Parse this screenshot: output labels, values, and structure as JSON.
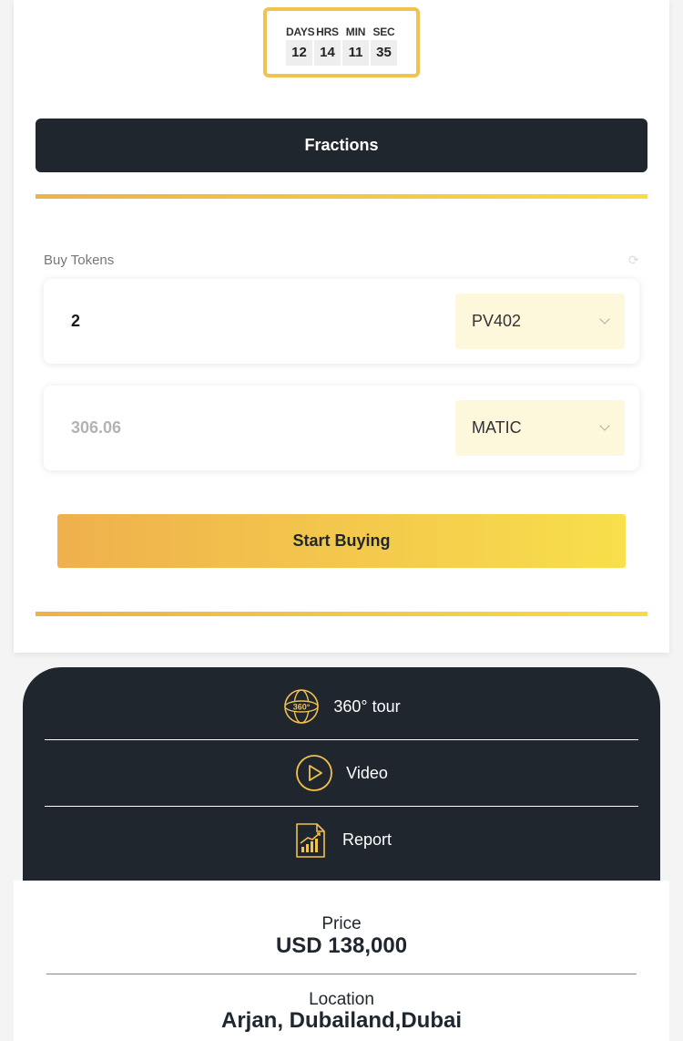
{
  "countdown": {
    "labels": {
      "days": "DAYS",
      "hrs": "HRS",
      "min": "MIN",
      "sec": "SEC"
    },
    "values": {
      "days": "12",
      "hrs": "14",
      "min": "11",
      "sec": "35"
    }
  },
  "fractions": {
    "label": "Fractions"
  },
  "buy": {
    "label": "Buy Tokens",
    "token_amount": "2",
    "token_select": "PV402",
    "pay_amount": "306.06",
    "pay_select": "MATIC",
    "start_label": "Start Buying"
  },
  "media": {
    "tour_label": "360° tour",
    "tour_icon_text": "360°",
    "video_label": "Video",
    "report_label": "Report"
  },
  "info": {
    "price_label": "Price",
    "price_value": "USD 138,000",
    "location_label": "Location",
    "location_value": "Arjan, Dubailand,Dubai"
  },
  "colors": {
    "dark": "#1f262e",
    "gold_start": "#efb04d",
    "gold_end": "#f8df4b",
    "select_bg": "#fdf7dc"
  },
  "icons": [
    "360-tour-icon",
    "play-icon",
    "report-icon",
    "chevron-down-icon",
    "refresh-icon"
  ]
}
